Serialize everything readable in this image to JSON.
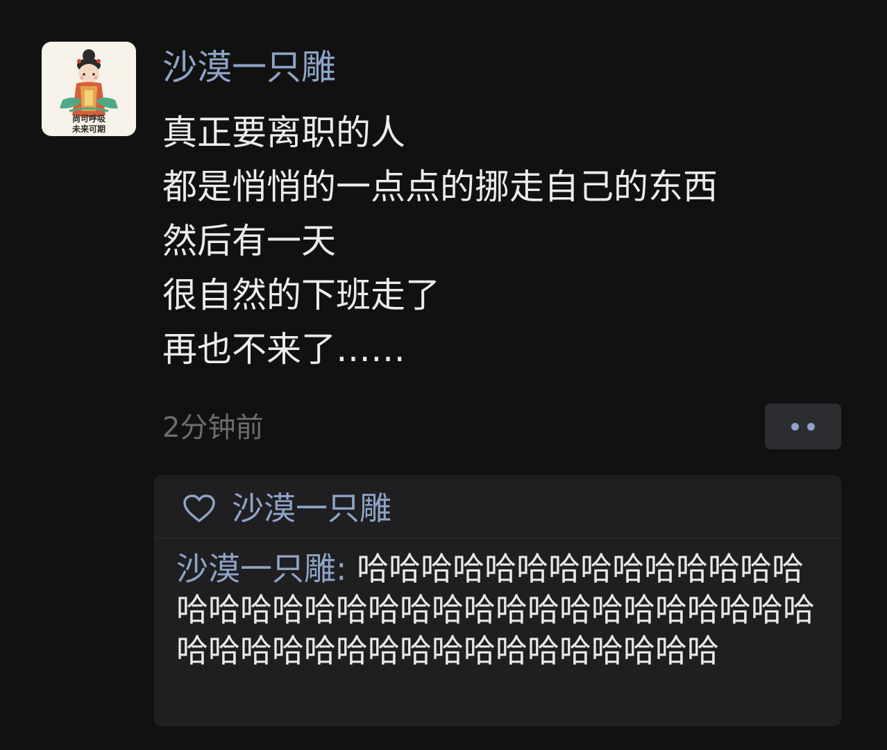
{
  "post": {
    "author": "沙漠一只雕",
    "avatar": {
      "caption_line1": "尚可呼吸",
      "caption_line2": "未来可期"
    },
    "lines": [
      "真正要离职的人",
      "都是悄悄的一点点的挪走自己的东西",
      "然后有一天",
      "很自然的下班走了",
      "再也不来了……"
    ],
    "timestamp": "2分钟前",
    "more_icon": "more-dots-icon"
  },
  "likes": {
    "icon": "heart-icon",
    "names": "沙漠一只雕"
  },
  "comments": [
    {
      "author": "沙漠一只雕",
      "separator": ": ",
      "text": "哈哈哈哈哈哈哈哈哈哈哈哈哈哈哈哈哈哈哈哈哈哈哈哈哈哈哈哈哈哈哈哈哈哈哈哈哈哈哈哈哈哈哈哈哈哈哈哈哈哈哈"
    }
  ],
  "colors": {
    "background": "#111112",
    "name_accent": "#8ea3c6",
    "body_text": "#ececec",
    "timestamp": "#6d6d70",
    "panel": "#1f1f21",
    "button": "#2b2d31"
  }
}
